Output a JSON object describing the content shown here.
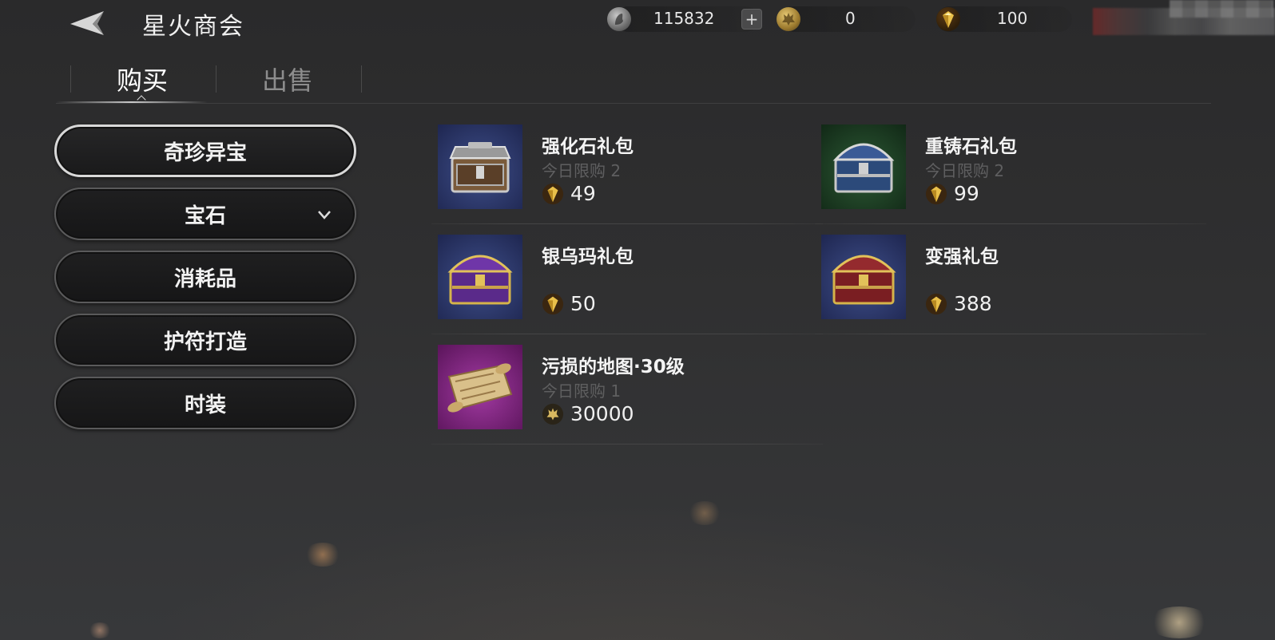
{
  "header": {
    "title": "星火商会",
    "currencies": [
      {
        "name": "silver-coin",
        "value": "115832",
        "has_plus": true,
        "plus_label": "+"
      },
      {
        "name": "bronze-token",
        "value": "0"
      },
      {
        "name": "gold-diamond",
        "value": "100"
      }
    ]
  },
  "tabs": [
    {
      "label": "购买",
      "active": true
    },
    {
      "label": "出售",
      "active": false
    }
  ],
  "categories": [
    {
      "label": "奇珍异宝",
      "active": true
    },
    {
      "label": "宝石",
      "active": false,
      "has_dropdown": true
    },
    {
      "label": "消耗品",
      "active": false
    },
    {
      "label": "护符打造",
      "active": false
    },
    {
      "label": "时装",
      "active": false
    }
  ],
  "items": [
    {
      "name": "强化石礼包",
      "limit": "今日限购 2",
      "price": "49",
      "currency": "gold-diamond",
      "thumb": "silver-chest",
      "thumb_bg": "#2e3a6a"
    },
    {
      "name": "重铸石礼包",
      "limit": "今日限购 2",
      "price": "99",
      "currency": "gold-diamond",
      "thumb": "blue-chest",
      "thumb_bg": "#1f4a2a"
    },
    {
      "name": "银乌玛礼包",
      "limit": "",
      "price": "50",
      "currency": "gold-diamond",
      "thumb": "purple-chest",
      "thumb_bg": "#2e3a6a"
    },
    {
      "name": "变强礼包",
      "limit": "",
      "price": "388",
      "currency": "gold-diamond",
      "thumb": "red-chest",
      "thumb_bg": "#2e3a6a"
    },
    {
      "name": "污损的地图·30级",
      "limit": "今日限购 1",
      "price": "30000",
      "currency": "bronze-token",
      "thumb": "map-scroll",
      "thumb_bg": "#7a1f7a"
    }
  ],
  "colors": {
    "gold": "#e2b743",
    "bronze": "#c9a24a",
    "silver": "#9a9a9a"
  }
}
